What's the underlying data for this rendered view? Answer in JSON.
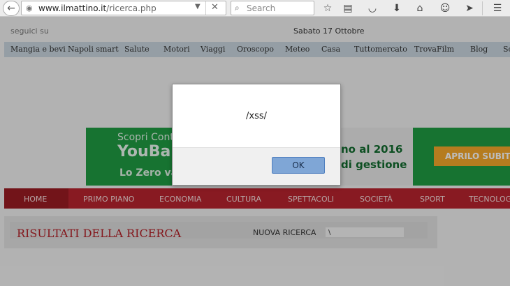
{
  "browser": {
    "url_domain": "www.ilmattino.it",
    "url_path": "/ricerca.php",
    "search_placeholder": "Search",
    "icons": [
      "back-icon",
      "globe-icon",
      "dropdown-icon",
      "clear-url-icon",
      "search-icon",
      "star-icon",
      "reading-list-icon",
      "pocket-icon",
      "download-icon",
      "home-icon",
      "chat-icon",
      "send-icon",
      "menu-icon"
    ]
  },
  "page": {
    "follow_label": "seguici su",
    "date": "Sabato 17 Ottobre",
    "top_nav": [
      "Mangia e bevi",
      "Napoli smart",
      "Salute",
      "Motori",
      "Viaggi",
      "Oroscopo",
      "Meteo",
      "Casa",
      "Tuttomercato",
      "TrovaFilm",
      "Blog",
      "Sc"
    ],
    "banner": {
      "line1": "Scopri Cont",
      "line2": "YouBa",
      "line3": "Lo Zero va",
      "line4": "no al 2016",
      "line5": "di gestione",
      "cta": "APRILO SUBIT"
    },
    "main_nav": [
      "HOME",
      "PRIMO PIANO",
      "ECONOMIA",
      "CULTURA",
      "SPETTACOLI",
      "SOCIETÀ",
      "SPORT",
      "TECNOLOG"
    ],
    "results_title": "RISULTATI DELLA RICERCA",
    "new_search_label": "NUOVA RICERCA",
    "new_search_value": "\\"
  },
  "dialog": {
    "message": "/xss/",
    "ok_label": "OK"
  },
  "colors": {
    "nav_red": "#b8242e",
    "banner_green": "#1f9b43",
    "cta_orange": "#f4a82a",
    "results_title_red": "#b31f27",
    "ok_button_blue": "#7fa6d6"
  }
}
